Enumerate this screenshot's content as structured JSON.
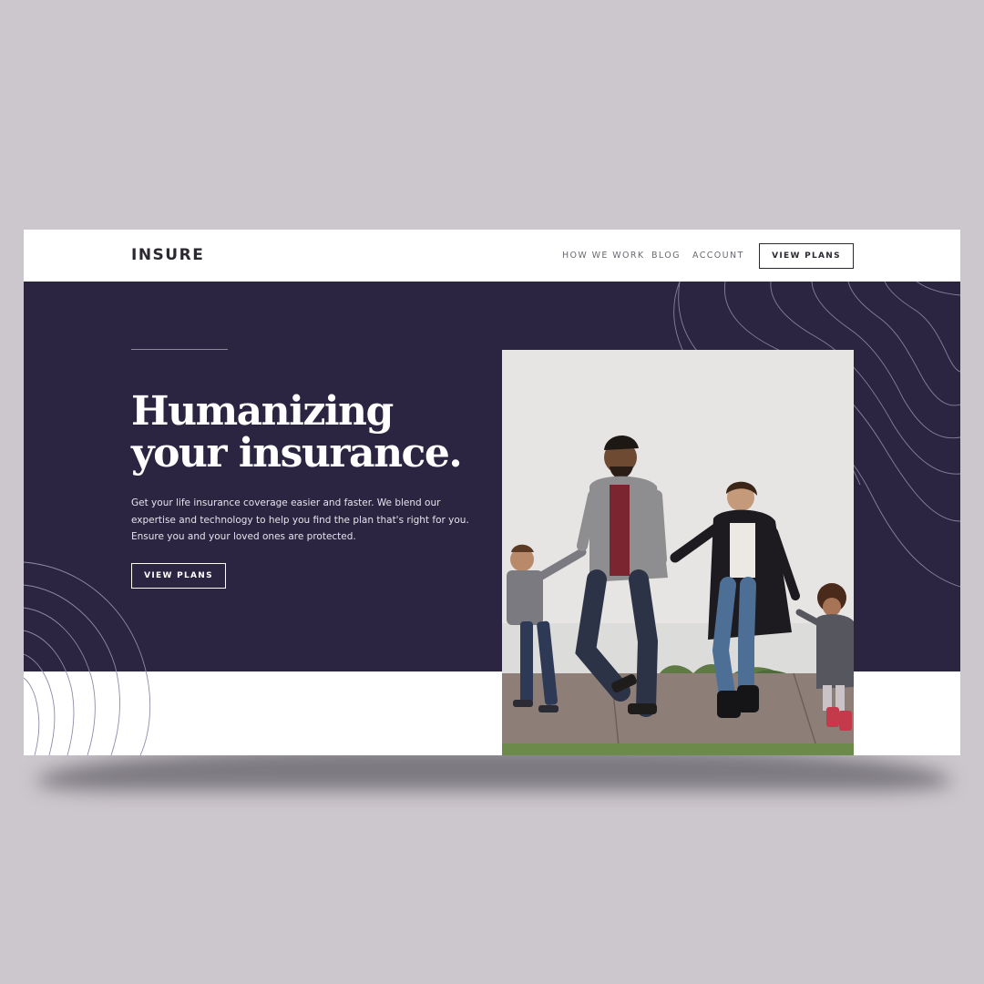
{
  "brand": {
    "logo_text": "INSURE"
  },
  "nav": {
    "links": [
      "HOW WE WORK",
      "BLOG",
      "ACCOUNT"
    ],
    "cta_label": "VIEW PLANS"
  },
  "hero": {
    "title_line1": "Humanizing",
    "title_line2": "your insurance.",
    "body": "Get your life insurance coverage easier and faster. We blend our expertise and technology to help you find the plan that's right for you. Ensure you and your loved ones are protected.",
    "cta_label": "VIEW PLANS",
    "image_alt": "family-walking-photo"
  },
  "colors": {
    "page_background": "#ccc7cd",
    "hero_background": "#2c2541",
    "text_dark": "#2c2830",
    "text_light": "#ffffff",
    "contour_line": "#6c65c8"
  }
}
